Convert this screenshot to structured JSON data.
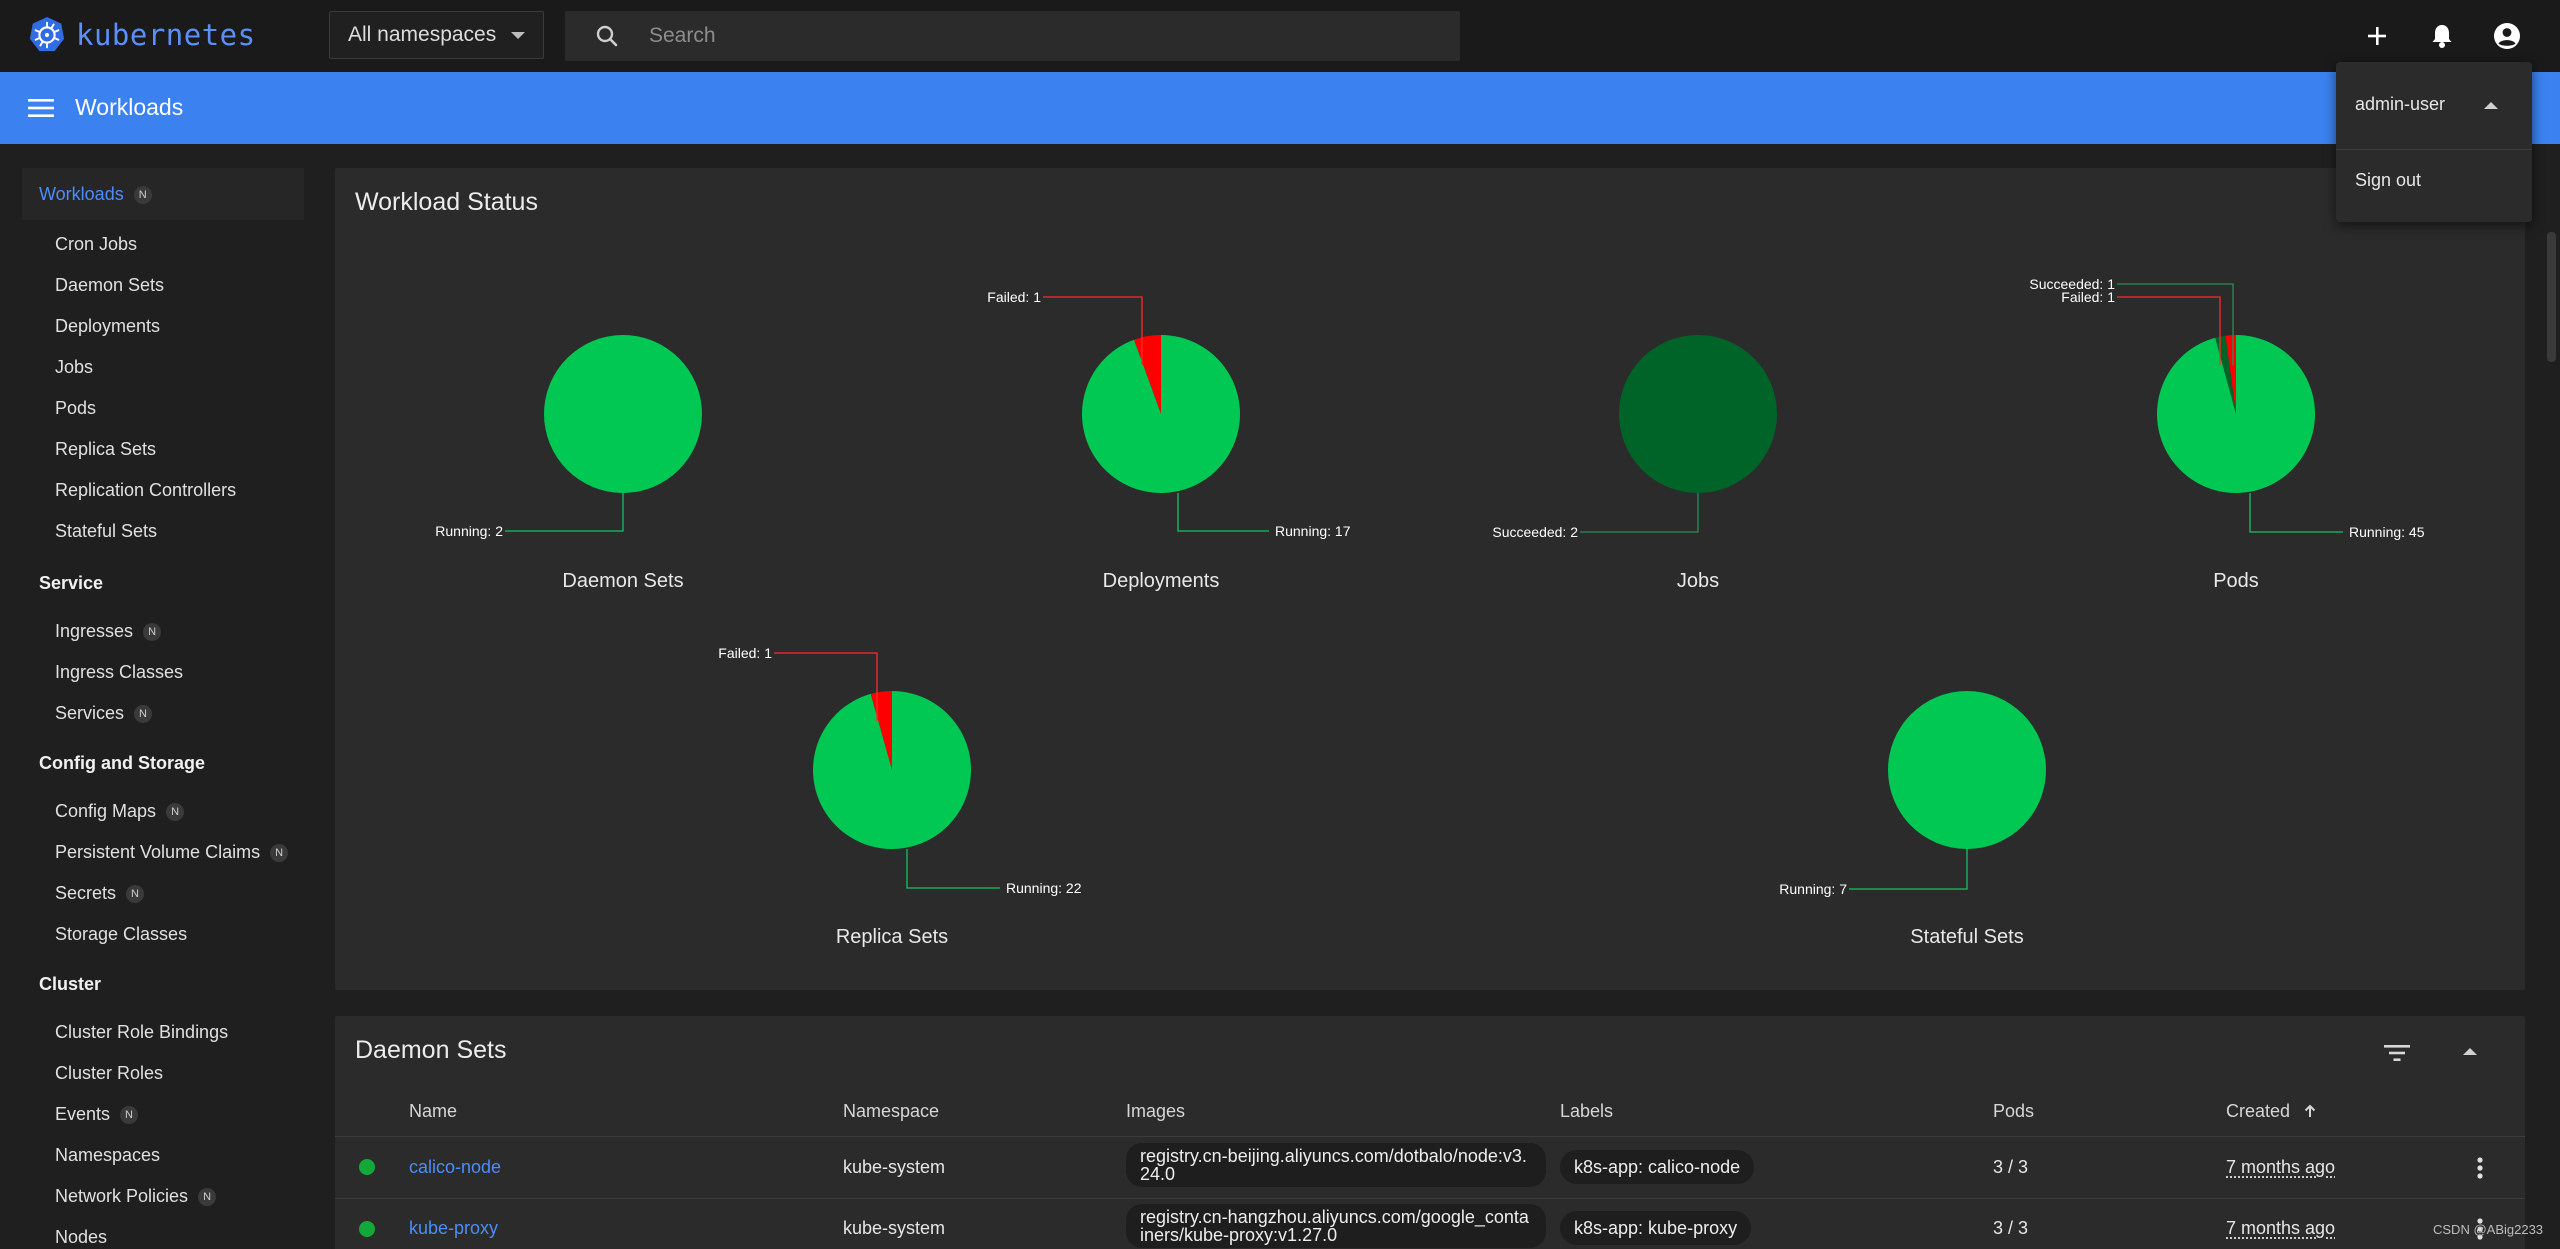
{
  "app": {
    "logo_text": "kubernetes"
  },
  "topbar": {
    "namespace_selected": "All namespaces",
    "search_placeholder": "Search"
  },
  "header": {
    "title": "Workloads"
  },
  "user_menu": {
    "username": "admin-user",
    "sign_out": "Sign out"
  },
  "sidebar": {
    "active": {
      "label": "Workloads",
      "badge": "N"
    },
    "workload_items": [
      "Cron Jobs",
      "Daemon Sets",
      "Deployments",
      "Jobs",
      "Pods",
      "Replica Sets",
      "Replication Controllers",
      "Stateful Sets"
    ],
    "service_title": "Service",
    "service_items": [
      {
        "label": "Ingresses",
        "badge": "N"
      },
      {
        "label": "Ingress Classes",
        "badge": ""
      },
      {
        "label": "Services",
        "badge": "N"
      }
    ],
    "config_title": "Config and Storage",
    "config_items": [
      {
        "label": "Config Maps",
        "badge": "N"
      },
      {
        "label": "Persistent Volume Claims",
        "badge": "N"
      },
      {
        "label": "Secrets",
        "badge": "N"
      },
      {
        "label": "Storage Classes",
        "badge": ""
      }
    ],
    "cluster_title": "Cluster",
    "cluster_items": [
      {
        "label": "Cluster Role Bindings",
        "badge": ""
      },
      {
        "label": "Cluster Roles",
        "badge": ""
      },
      {
        "label": "Events",
        "badge": "N"
      },
      {
        "label": "Namespaces",
        "badge": ""
      },
      {
        "label": "Network Policies",
        "badge": "N"
      },
      {
        "label": "Nodes",
        "badge": ""
      }
    ]
  },
  "workload_status": {
    "title": "Workload Status",
    "colors": {
      "running": "#00c853",
      "failed": "#ff0000",
      "succeeded": "#006428"
    }
  },
  "chart_data": [
    {
      "type": "pie",
      "title": "Daemon Sets",
      "slices": [
        {
          "label": "Running: 2",
          "value": 2,
          "status": "running"
        }
      ]
    },
    {
      "type": "pie",
      "title": "Deployments",
      "slices": [
        {
          "label": "Running: 17",
          "value": 17,
          "status": "running"
        },
        {
          "label": "Failed: 1",
          "value": 1,
          "status": "failed"
        }
      ]
    },
    {
      "type": "pie",
      "title": "Jobs",
      "slices": [
        {
          "label": "Succeeded: 2",
          "value": 2,
          "status": "succeeded"
        }
      ]
    },
    {
      "type": "pie",
      "title": "Pods",
      "slices": [
        {
          "label": "Running: 45",
          "value": 45,
          "status": "running"
        },
        {
          "label": "Failed: 1",
          "value": 1,
          "status": "failed"
        },
        {
          "label": "Succeeded: 1",
          "value": 1,
          "status": "succeeded"
        }
      ]
    },
    {
      "type": "pie",
      "title": "Replica Sets",
      "slices": [
        {
          "label": "Running: 22",
          "value": 22,
          "status": "running"
        },
        {
          "label": "Failed: 1",
          "value": 1,
          "status": "failed"
        }
      ]
    },
    {
      "type": "pie",
      "title": "Stateful Sets",
      "slices": [
        {
          "label": "Running: 7",
          "value": 7,
          "status": "running"
        }
      ]
    }
  ],
  "daemon_sets": {
    "title": "Daemon Sets",
    "columns": [
      "Name",
      "Namespace",
      "Images",
      "Labels",
      "Pods",
      "Created"
    ],
    "rows": [
      {
        "name": "calico-node",
        "namespace": "kube-system",
        "image": "registry.cn-beijing.aliyuncs.com/dotbalo/node:v3.24.0",
        "label": "k8s-app: calico-node",
        "pods": "3 / 3",
        "created": "7 months ago"
      },
      {
        "name": "kube-proxy",
        "namespace": "kube-system",
        "image": "registry.cn-hangzhou.aliyuncs.com/google_containers/kube-proxy:v1.27.0",
        "label": "k8s-app: kube-proxy",
        "pods": "3 / 3",
        "created": "7 months ago"
      }
    ]
  },
  "watermark": "CSDN @ABig2233"
}
